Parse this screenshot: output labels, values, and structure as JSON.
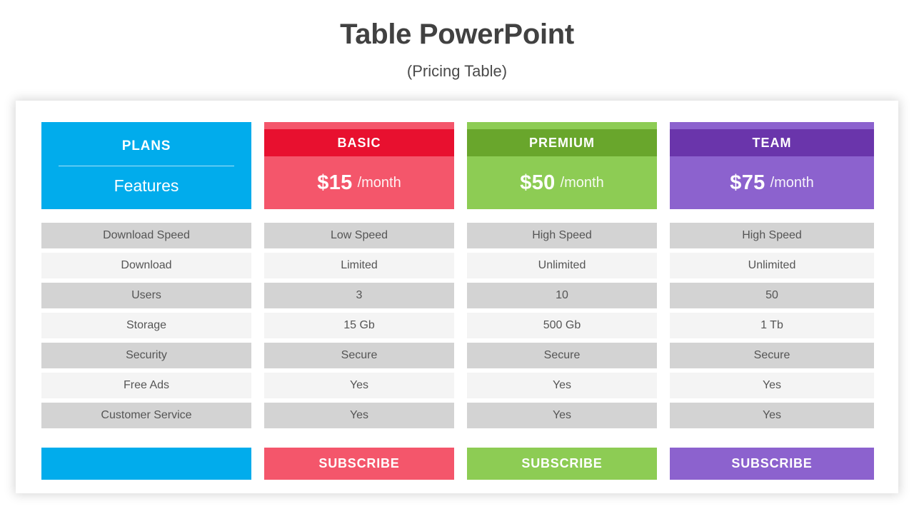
{
  "heading": {
    "title": "Table PowerPoint",
    "subtitle": "(Pricing Table)"
  },
  "colors": {
    "plans": "#01ACEC",
    "basic_dark": "#E8102F",
    "basic_light": "#F4566B",
    "premium_dark": "#69A62C",
    "premium_light": "#8DCC54",
    "team_dark": "#6A35AB",
    "team_light": "#8C62CE",
    "row_odd": "#D3D3D3",
    "row_even": "#F4F4F4",
    "text": "#555555",
    "title_text": "#414141"
  },
  "plans_column": {
    "title": "PLANS",
    "subtitle": "Features",
    "features": [
      "Download Speed",
      "Download",
      "Users",
      "Storage",
      "Security",
      "Free Ads",
      "Customer Service"
    ],
    "button_label": ""
  },
  "plans": [
    {
      "name": "BASIC",
      "price": "$15",
      "period": "/month",
      "band_color": "#E8102F",
      "body_color": "#F4566B",
      "button_label": "SUBSCRIBE",
      "values": [
        "Low Speed",
        "Limited",
        "3",
        "15 Gb",
        "Secure",
        "Yes",
        "Yes"
      ]
    },
    {
      "name": "PREMIUM",
      "price": "$50",
      "period": "/month",
      "band_color": "#69A62C",
      "body_color": "#8DCC54",
      "button_label": "SUBSCRIBE",
      "values": [
        "High Speed",
        "Unlimited",
        "10",
        "500 Gb",
        "Secure",
        "Yes",
        "Yes"
      ]
    },
    {
      "name": "TEAM",
      "price": "$75",
      "period": "/month",
      "band_color": "#6A35AB",
      "body_color": "#8C62CE",
      "button_label": "SUBSCRIBE",
      "values": [
        "High Speed",
        "Unlimited",
        "50",
        "1 Tb",
        "Secure",
        "Yes",
        "Yes"
      ]
    }
  ]
}
